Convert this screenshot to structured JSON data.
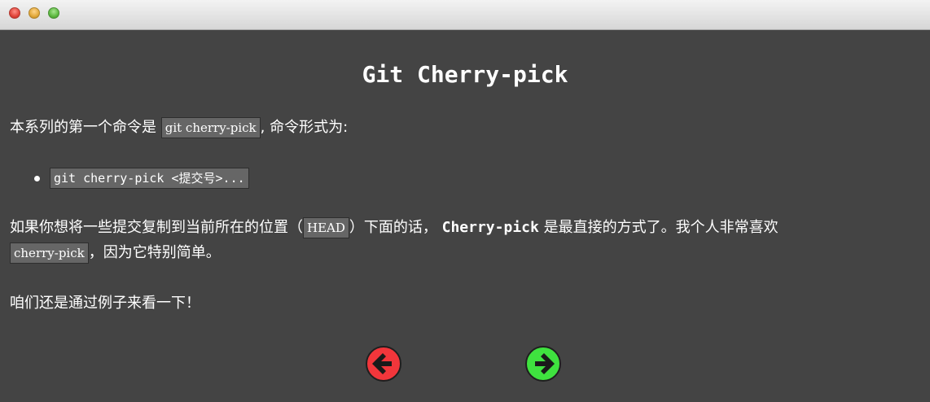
{
  "window": {
    "controls": [
      "close",
      "minimize",
      "zoom"
    ]
  },
  "main": {
    "title": "Git Cherry-pick",
    "intro_before": "本系列的第一个命令是 ",
    "intro_code": "git cherry-pick",
    "intro_after": ", 命令形式为:",
    "bullet_code": "git cherry-pick <提交号>...",
    "para2_before": "如果你想将一些提交复制到当前所在的位置（",
    "para2_head": "HEAD",
    "para2_mid": "）下面的话， ",
    "para2_strong": "Cherry-pick",
    "para2_after": " 是最直接的方式了。我个人非常喜欢",
    "para2_code": "cherry-pick",
    "para2_end": "，因为它特别简单。",
    "para3": "咱们还是通过例子来看一下！"
  },
  "navigation": {
    "prev_icon": "arrow-left-icon",
    "next_icon": "arrow-right-icon",
    "prev_color": "#f2363b",
    "next_color": "#3fe23f"
  }
}
